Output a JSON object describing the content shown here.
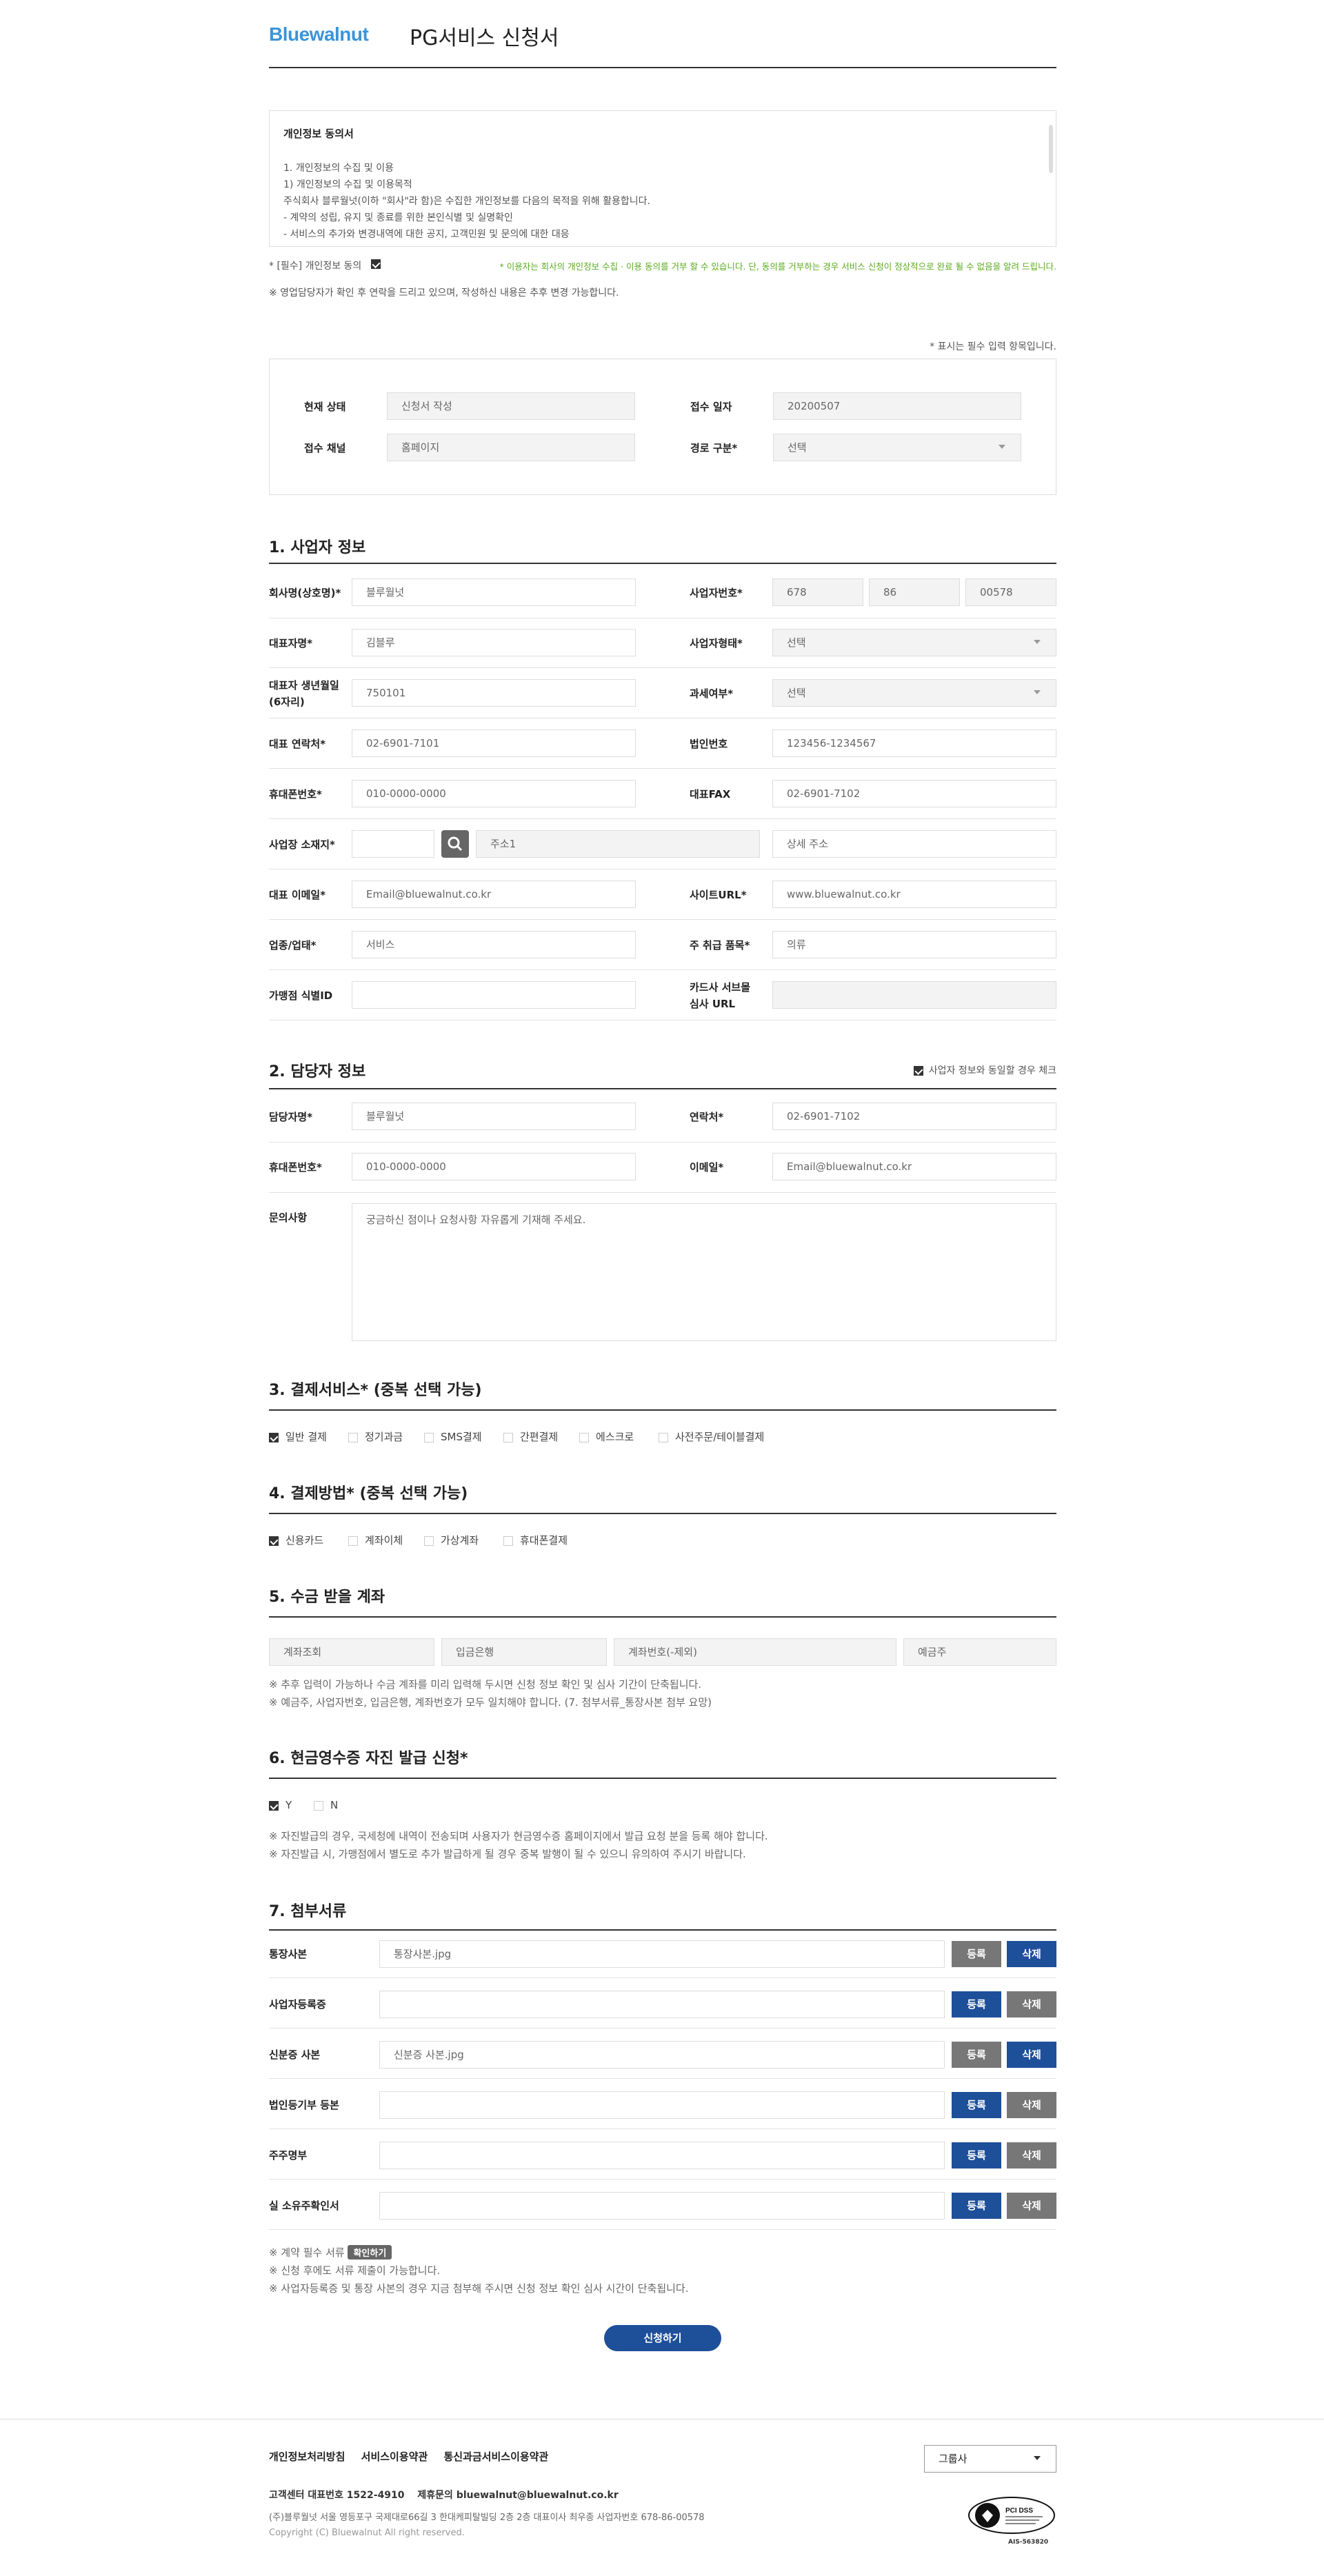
{
  "header": {
    "logo": "Bluewalnut",
    "title": "PG서비스 신청서"
  },
  "privacy": {
    "box_title": "개인정보 동의서",
    "lines": [
      "1. 개인정보의 수집 및 이용",
      "1) 개인정보의 수집 및 이용목적",
      "주식회사 블루월넛(이하 \"회사\"라 함)은 수집한 개인정보를 다음의 목적을 위해 활용합니다.",
      "- 계약의 성립, 유지 및 종료를 위한 본인식별 및 실명확인",
      "- 서비스의 추가와 변경내역에 대한 공지, 고객민원 및 문의에 대한 대응"
    ],
    "agree_label": "* [필수] 개인정보 동의",
    "warning": "* 이용자는 회사의 개인정보 수집 · 이용 동의를 거부 할 수 있습니다. 단, 동의를 거부하는 경우 서비스 신청이 정상적으로 완료 될 수 없음을 알려 드립니다.",
    "sales_note": "※ 영업담당자가 확인 후 연락을 드리고 있으며, 작성하신 내용은 추후 변경 가능합니다."
  },
  "required_note": "* 표시는 필수 입력 항목입니다.",
  "status": {
    "state_label": "현재 상태",
    "state_value": "신청서 작성",
    "date_label": "접수 일자",
    "date_value": "20200507",
    "channel_label": "접수 채널",
    "channel_value": "홈페이지",
    "route_label": "경로 구분*",
    "route_value": "선택"
  },
  "business": {
    "title": "1. 사업자 정보",
    "company_label": "회사명(상호명)*",
    "company_value": "블루월넛",
    "bizno_label": "사업자번호*",
    "bizno_1": "678",
    "bizno_2": "86",
    "bizno_3": "00578",
    "ceo_label": "대표자명*",
    "ceo_value": "김블루",
    "biztype_label": "사업자형태*",
    "biztype_value": "선택",
    "birth_label_1": "대표자 생년월일",
    "birth_label_2": "(6자리)",
    "birth_value": "750101",
    "tax_label": "과세여부*",
    "tax_value": "선택",
    "tel_label": "대표 연락처*",
    "tel_value": "02-6901-7101",
    "corpno_label": "법인번호",
    "corpno_value": "123456-1234567",
    "mobile_label": "휴대폰번호*",
    "mobile_value": "010-0000-0000",
    "fax_label": "대표FAX",
    "fax_value": "02-6901-7102",
    "addr_label": "사업장 소재지*",
    "addr1_placeholder": "주소1",
    "addr2_placeholder": "상세 주소",
    "email_label": "대표 이메일*",
    "email_value": "Email@bluewalnut.co.kr",
    "site_label": "사이트URL*",
    "site_value": "www.bluewalnut.co.kr",
    "industry_label": "업종/업태*",
    "industry_value": "서비스",
    "goods_label": "주 취급 품목*",
    "goods_value": "의류",
    "mid_label": "가맹점 식별ID",
    "review_label_1": "카드사 서브몰",
    "review_label_2": "심사 URL"
  },
  "manager": {
    "title": "2. 담당자 정보",
    "same_label": "사업자 정보와 동일할 경우 체크",
    "name_label": "담당자명*",
    "name_value": "블루월넛",
    "tel_label": "연락처*",
    "tel_value": "02-6901-7102",
    "mobile_label": "휴대폰번호*",
    "mobile_value": "010-0000-0000",
    "email_label": "이메일*",
    "email_value": "Email@bluewalnut.co.kr",
    "inquiry_label": "문의사항",
    "inquiry_placeholder": "궁금하신 점이나 요청사항 자유롭게 기재해 주세요."
  },
  "services": {
    "title": "3. 결제서비스* (중복 선택 가능)",
    "options": [
      {
        "label": "일반 결제",
        "checked": true
      },
      {
        "label": "정기과금",
        "checked": false
      },
      {
        "label": "SMS결제",
        "checked": false
      },
      {
        "label": "간편결제",
        "checked": false
      },
      {
        "label": "에스크로",
        "checked": false
      },
      {
        "label": "사전주문/테이블결제",
        "checked": false
      }
    ]
  },
  "methods": {
    "title": "4. 결제방법* (중복 선택 가능)",
    "options": [
      {
        "label": "신용카드",
        "checked": true
      },
      {
        "label": "계좌이체",
        "checked": false
      },
      {
        "label": "가상계좌",
        "checked": false
      },
      {
        "label": "휴대폰결제",
        "checked": false
      }
    ]
  },
  "account": {
    "title": "5. 수금 받을 계좌",
    "lookup": "계좌조회",
    "bank": "입금은행",
    "number": "계좌번호(-제외)",
    "holder": "예금주",
    "note1": "※ 추후 입력이 가능하나 수금 계좌를 미리 입력해 두시면 신청 정보 확인 및 심사 기간이 단축됩니다.",
    "note2": "※ 예금주, 사업자번호, 입금은행, 계좌번호가 모두 일치해야 합니다. (7. 첨부서류_통장사본 첨부 요망)"
  },
  "receipt": {
    "title": "6. 현금영수증 자진 발급 신청*",
    "yes": "Y",
    "no": "N",
    "note1": "※ 자진발급의 경우, 국세청에 내역이 전송되며 사용자가 현금영수증 홈페이지에서 발급 요청 분을 등록 해야 합니다.",
    "note2": "※ 자진발급 시, 가맹점에서 별도로 추가 발급하게 될 경우 중복 발행이 될 수 있으니 유의하여 주시기 바랍니다."
  },
  "attach": {
    "title": "7. 첨부서류",
    "register": "등록",
    "delete": "삭제",
    "rows": [
      {
        "label": "통장사본",
        "file": "통장사본.jpg"
      },
      {
        "label": "사업자등록증",
        "file": ""
      },
      {
        "label": "신분증 사본",
        "file": "신분증 사본.jpg"
      },
      {
        "label": "법인등기부 등본",
        "file": ""
      },
      {
        "label": "주주명부",
        "file": ""
      },
      {
        "label": "실 소유주확인서",
        "file": ""
      }
    ],
    "note1": "※ 계약 필수 서류",
    "confirm_btn": "확인하기",
    "note2": "※ 신청 후에도 서류 제출이 가능합니다.",
    "note3": "※ 사업자등록증 및 통장 사본의 경우 지금 첨부해 주시면 신청 정보 확인 심사 시간이 단축됩니다."
  },
  "submit": "신청하기",
  "footer": {
    "links": [
      "개인정보처리방침",
      "서비스이용약관",
      "통신과금서비스이용약관"
    ],
    "group_select": "그룹사",
    "center": "고객센터 대표번호 1522-4910",
    "partner": "제휴문의 bluewalnut@bluewalnut.co.kr",
    "address": "(주)블루월넛 서울 영등포구 국제대로66길 3 한대케피탈빌딩 2층 2층   대표이사 최우종   사업자번호 678-86-00578",
    "copyright": "Copyright (C) Bluewalnut All right reserved.",
    "pci_text": "PCI DSS",
    "pci_sub": "AIS-563820"
  },
  "colors": {
    "brand": "#3b94d9",
    "primary": "#1e4f99",
    "warning": "#5aab1e",
    "button_gray": "#777777"
  }
}
